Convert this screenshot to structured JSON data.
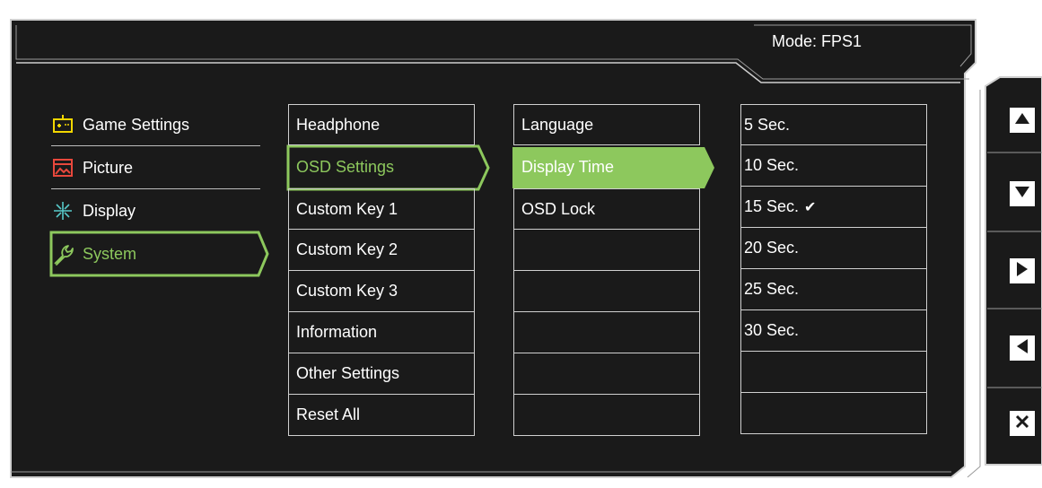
{
  "header": {
    "mode_label": "Mode: FPS1"
  },
  "categories": [
    {
      "label": "Game Settings",
      "icon": "gamepad-icon",
      "selected": false
    },
    {
      "label": "Picture",
      "icon": "picture-icon",
      "selected": false
    },
    {
      "label": "Display",
      "icon": "display-arrows-icon",
      "selected": false
    },
    {
      "label": "System",
      "icon": "wrench-icon",
      "selected": true
    }
  ],
  "submenu": [
    {
      "label": "Headphone"
    },
    {
      "label": "OSD Settings",
      "selected": true
    },
    {
      "label": "Custom Key 1"
    },
    {
      "label": "Custom Key 2"
    },
    {
      "label": "Custom Key 3"
    },
    {
      "label": "Information"
    },
    {
      "label": "Other Settings"
    },
    {
      "label": "Reset All"
    }
  ],
  "osd_options": [
    {
      "label": "Language"
    },
    {
      "label": "Display Time",
      "highlighted": true
    },
    {
      "label": "OSD Lock"
    },
    {
      "label": ""
    },
    {
      "label": ""
    },
    {
      "label": ""
    },
    {
      "label": ""
    },
    {
      "label": ""
    }
  ],
  "display_time_values": [
    {
      "label": "5 Sec."
    },
    {
      "label": "10 Sec."
    },
    {
      "label": "15 Sec.",
      "checked": true
    },
    {
      "label": "20 Sec."
    },
    {
      "label": "25 Sec."
    },
    {
      "label": "30 Sec."
    },
    {
      "label": ""
    },
    {
      "label": ""
    }
  ],
  "nav_keys": [
    {
      "icon": "up-arrow-icon"
    },
    {
      "icon": "down-arrow-icon"
    },
    {
      "icon": "right-arrow-icon"
    },
    {
      "icon": "left-arrow-icon"
    },
    {
      "icon": "close-icon"
    }
  ],
  "colors": {
    "background": "#1a1a1a",
    "accent": "#8dc85d",
    "border": "#d0d0d0"
  }
}
